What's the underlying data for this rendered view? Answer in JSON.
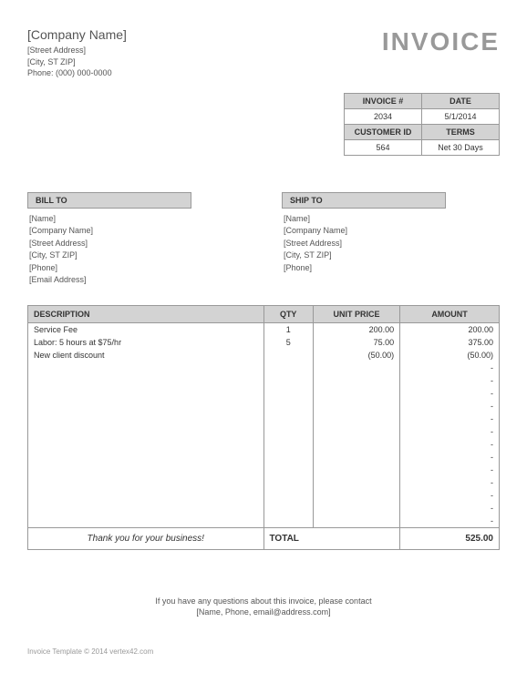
{
  "header": {
    "company_name": "[Company Name]",
    "street": "[Street Address]",
    "city_line": "[City, ST  ZIP]",
    "phone": "Phone: (000) 000-0000",
    "title": "INVOICE"
  },
  "meta": {
    "invoice_label": "INVOICE #",
    "invoice_value": "2034",
    "date_label": "DATE",
    "date_value": "5/1/2014",
    "customer_label": "CUSTOMER ID",
    "customer_value": "564",
    "terms_label": "TERMS",
    "terms_value": "Net 30 Days"
  },
  "bill_to": {
    "header": "BILL TO",
    "name": "[Name]",
    "company": "[Company Name]",
    "street": "[Street Address]",
    "city_line": "[City, ST  ZIP]",
    "phone": "[Phone]",
    "email": "[Email Address]"
  },
  "ship_to": {
    "header": "SHIP TO",
    "name": "[Name]",
    "company": "[Company Name]",
    "street": "[Street Address]",
    "city_line": "[City, ST  ZIP]",
    "phone": "[Phone]"
  },
  "items": {
    "headers": {
      "description": "DESCRIPTION",
      "qty": "QTY",
      "unit_price": "UNIT PRICE",
      "amount": "AMOUNT"
    },
    "rows": [
      {
        "description": "Service Fee",
        "qty": "1",
        "unit_price": "200.00",
        "amount": "200.00"
      },
      {
        "description": "Labor: 5 hours at $75/hr",
        "qty": "5",
        "unit_price": "75.00",
        "amount": "375.00"
      },
      {
        "description": "New client discount",
        "qty": "",
        "unit_price": "(50.00)",
        "amount": "(50.00)"
      },
      {
        "description": "",
        "qty": "",
        "unit_price": "",
        "amount": "-"
      },
      {
        "description": "",
        "qty": "",
        "unit_price": "",
        "amount": "-"
      },
      {
        "description": "",
        "qty": "",
        "unit_price": "",
        "amount": "-"
      },
      {
        "description": "",
        "qty": "",
        "unit_price": "",
        "amount": "-"
      },
      {
        "description": "",
        "qty": "",
        "unit_price": "",
        "amount": "-"
      },
      {
        "description": "",
        "qty": "",
        "unit_price": "",
        "amount": "-"
      },
      {
        "description": "",
        "qty": "",
        "unit_price": "",
        "amount": "-"
      },
      {
        "description": "",
        "qty": "",
        "unit_price": "",
        "amount": "-"
      },
      {
        "description": "",
        "qty": "",
        "unit_price": "",
        "amount": "-"
      },
      {
        "description": "",
        "qty": "",
        "unit_price": "",
        "amount": "-"
      },
      {
        "description": "",
        "qty": "",
        "unit_price": "",
        "amount": "-"
      },
      {
        "description": "",
        "qty": "",
        "unit_price": "",
        "amount": "-"
      },
      {
        "description": "",
        "qty": "",
        "unit_price": "",
        "amount": "-"
      }
    ]
  },
  "total": {
    "thank_you": "Thank you for your business!",
    "label": "TOTAL",
    "amount": "525.00"
  },
  "footer": {
    "line1": "If you have any questions about this invoice, please contact",
    "line2": "[Name, Phone, email@address.com]"
  },
  "copyright": "Invoice Template © 2014 vertex42.com"
}
